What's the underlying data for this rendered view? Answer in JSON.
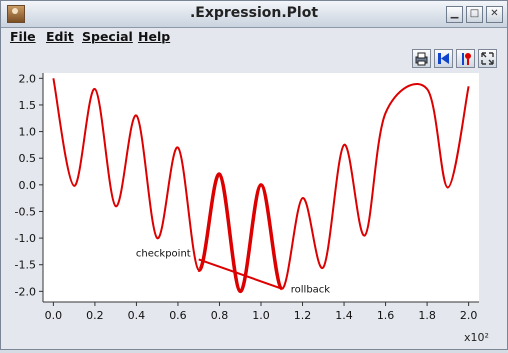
{
  "window": {
    "title": ".Expression.Plot"
  },
  "menubar": {
    "items": [
      "File",
      "Edit",
      "Special",
      "Help"
    ]
  },
  "toolbar": {
    "buttons": [
      "print-icon",
      "skip-to-start-icon",
      "marker-icon",
      "expand-icon"
    ]
  },
  "chart_data": {
    "type": "line",
    "title": "",
    "xlabel": "",
    "ylabel": "",
    "x_multiplier": "x10²",
    "xlim": [
      -0.05,
      2.05
    ],
    "ylim": [
      -2.2,
      2.1
    ],
    "xticks": [
      "0.0",
      "0.2",
      "0.4",
      "0.6",
      "0.8",
      "1.0",
      "1.2",
      "1.4",
      "1.6",
      "1.8",
      "2.0"
    ],
    "yticks": [
      "2.0",
      "1.5",
      "1.0",
      "0.5",
      "0.0",
      "-0.5",
      "-1.0",
      "-1.5",
      "-2.0"
    ],
    "grid": false,
    "series_color": "#dd0000",
    "series": [
      {
        "x": [
          0.0,
          0.1,
          0.2,
          0.3,
          0.4,
          0.5,
          0.6,
          0.7,
          0.8,
          0.9,
          1.0,
          1.1,
          1.2,
          1.3,
          1.4,
          1.5,
          1.6,
          1.8,
          1.9,
          2.0
        ],
        "y": [
          2.0,
          -0.02,
          1.8,
          -0.4,
          1.3,
          -1.0,
          0.7,
          -1.6,
          0.2,
          -2.0,
          0.0,
          -1.95,
          -0.25,
          -1.55,
          0.75,
          -0.95,
          1.35,
          1.8,
          -0.05,
          1.85
        ]
      }
    ],
    "annotations": [
      {
        "label": "checkpoint",
        "x": 0.7,
        "y": -1.4
      },
      {
        "label": "rollback",
        "x": 1.1,
        "y": -1.95
      }
    ]
  }
}
